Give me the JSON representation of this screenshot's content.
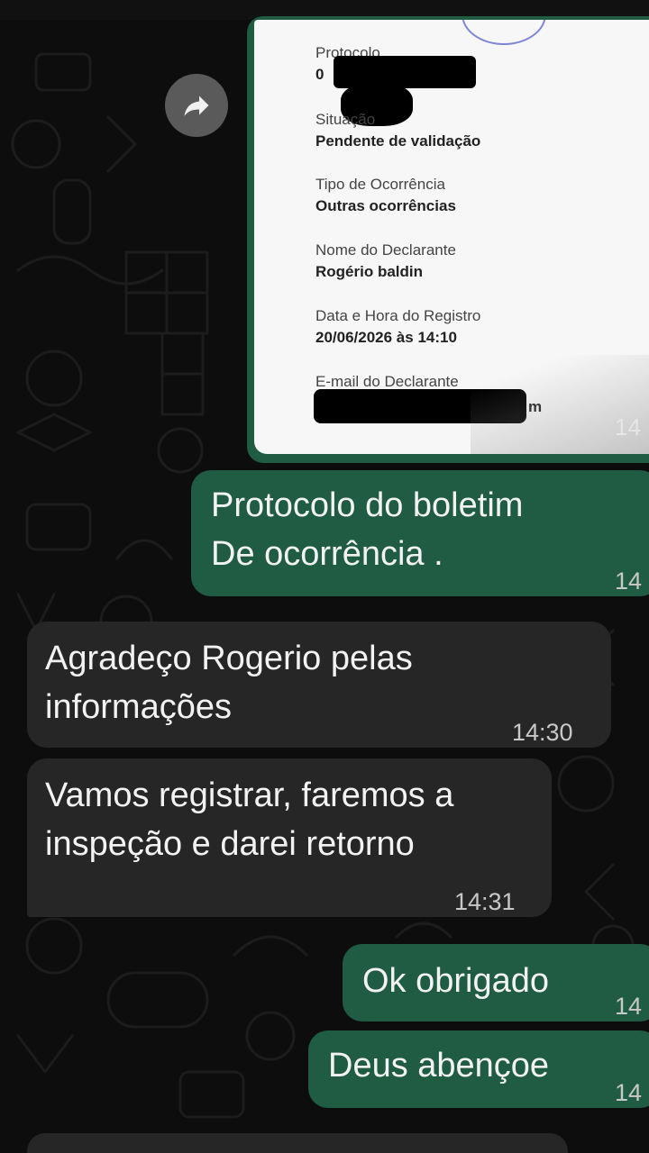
{
  "colors": {
    "outgoing_bubble": "#1f5c43",
    "incoming_bubble": "#262626",
    "background": "#0d0d0d"
  },
  "image_message": {
    "document": {
      "protocol_label": "Protocolo",
      "protocol_value": "0",
      "status_label": "Situação",
      "status_value": "Pendente de validação",
      "type_label": "Tipo de Ocorrência",
      "type_value": "Outras ocorrências",
      "declarant_label": "Nome do Declarante",
      "declarant_value": "Rogério baldin",
      "datetime_label": "Data e Hora do Registro",
      "datetime_value": "20/06/2026 às 14:10",
      "email_label": "E-mail do Declarante",
      "email_value_tail": "m"
    },
    "time": "14",
    "forward_icon": "share-forward-icon"
  },
  "messages": [
    {
      "direction": "out",
      "text": "Protocolo do boletim\nDe ocorrência .",
      "time": "14"
    },
    {
      "direction": "in",
      "text": "Agradeço Rogerio pelas\ninformações",
      "time": "14:30"
    },
    {
      "direction": "in",
      "text": "Vamos registrar, faremos a\ninspeção e darei retorno",
      "time": "14:31"
    },
    {
      "direction": "out",
      "text": "Ok obrigado",
      "time": "14"
    },
    {
      "direction": "out",
      "text": "Deus abençoe",
      "time": "14"
    }
  ]
}
